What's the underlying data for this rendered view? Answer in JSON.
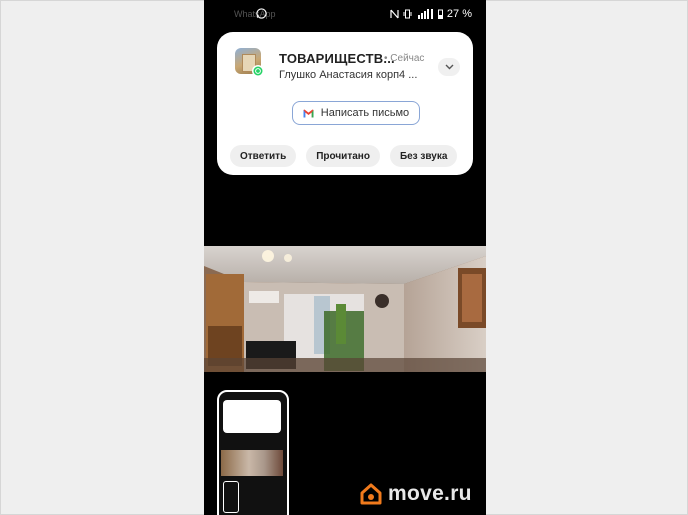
{
  "status_bar": {
    "app_name": "WhatsApp",
    "battery": "27 %",
    "icons": [
      "whatsapp-icon",
      "nfc-icon",
      "vibrate-icon",
      "signal-icon",
      "battery-icon"
    ]
  },
  "notification": {
    "title": "ТОВАРИЩЕСТВ...",
    "time": "• Сейчас",
    "subtitle": "Глушко Анастасия корп4 ...",
    "reply_button": "Написать письмо",
    "actions": [
      "Ответить",
      "Прочитано",
      "Без звука"
    ]
  },
  "watermark": {
    "text": "move.ru"
  },
  "colors": {
    "accent": "#8aa6d6",
    "watermark_orange": "#f07a1c",
    "background": "#000000"
  }
}
